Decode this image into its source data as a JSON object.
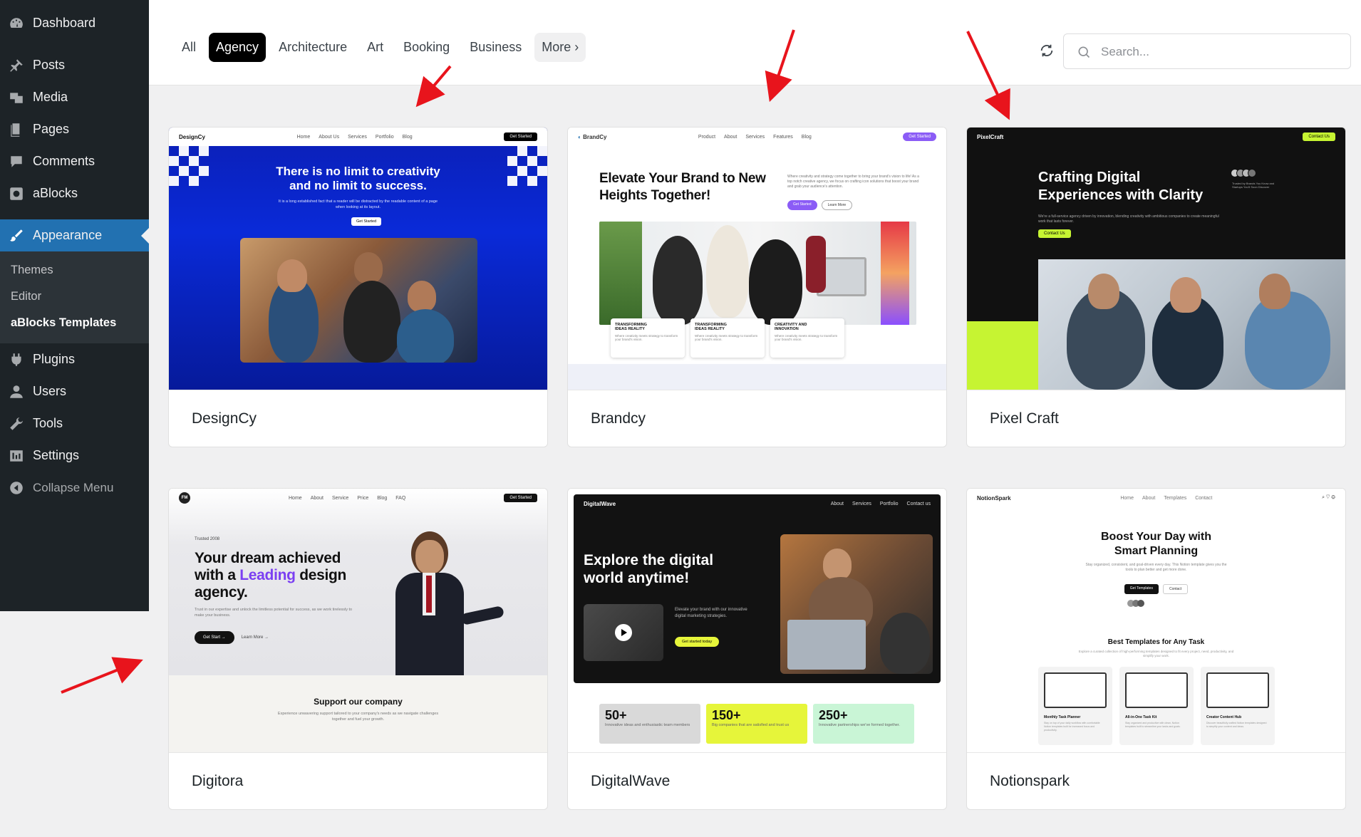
{
  "sidebar": {
    "items": [
      {
        "label": "Dashboard",
        "icon": "dashboard-icon"
      },
      {
        "label": "Posts",
        "icon": "pin-icon"
      },
      {
        "label": "Media",
        "icon": "media-icon"
      },
      {
        "label": "Pages",
        "icon": "pages-icon"
      },
      {
        "label": "Comments",
        "icon": "comment-icon"
      },
      {
        "label": "aBlocks",
        "icon": "ablocks-icon"
      },
      {
        "label": "Appearance",
        "icon": "brush-icon"
      }
    ],
    "submenu": [
      "Themes",
      "Editor",
      "aBlocks Templates"
    ],
    "items2": [
      {
        "label": "Plugins",
        "icon": "plugin-icon"
      },
      {
        "label": "Users",
        "icon": "user-icon"
      },
      {
        "label": "Tools",
        "icon": "wrench-icon"
      },
      {
        "label": "Settings",
        "icon": "settings-icon"
      }
    ],
    "collapse": "Collapse Menu"
  },
  "filters": {
    "categories": [
      "All",
      "Agency",
      "Architecture",
      "Art",
      "Booking",
      "Business"
    ],
    "active": "Agency",
    "more": "More ›"
  },
  "search": {
    "placeholder": "Search..."
  },
  "templates": [
    {
      "name": "DesignCy",
      "preview": {
        "logo": "DesignCy",
        "nav": [
          "Home",
          "About Us",
          "Services",
          "Portfolio",
          "Blog"
        ],
        "cta": "Get Started",
        "headline1": "There is no limit to creativity",
        "headline2": "and no limit to success.",
        "sub": "It is a long established fact that a reader will be distracted by the readable content of a page when looking at its layout.",
        "button": "Get Started"
      }
    },
    {
      "name": "Brandcy",
      "preview": {
        "logo": "BrandCy",
        "nav": [
          "Product",
          "About",
          "Services",
          "Features",
          "Blog"
        ],
        "cta": "Get Started",
        "headline1": "Elevate Your Brand to New",
        "headline2": "Heights Together!",
        "sub": "Where creativity and strategy come together to bring your brand's vision to life! As a top notch creative agency, we focus on crafting icon solutions that boost your brand and grab your audience's attention.",
        "btn1": "Get Started",
        "btn2": "Learn More",
        "features": [
          {
            "t1": "TRANSFORMING",
            "t2": "IDEAS REALITY",
            "d": "Where creativity meets strategy to transform your brand's vision."
          },
          {
            "t1": "TRANSFORMING",
            "t2": "IDEAS REALITY",
            "d": "Where creativity meets strategy to transform your brand's vision."
          },
          {
            "t1": "CREATIVITY AND",
            "t2": "INNOVATION",
            "d": "Where creativity meets strategy to transform your brand's vision."
          }
        ]
      }
    },
    {
      "name": "Pixel Craft",
      "preview": {
        "logo": "PixelCraft",
        "cta": "Contact Us",
        "headline1": "Crafting Digital",
        "headline2": "Experiences with Clarity",
        "sub": "We're a full-service agency driven by innovation, blending creativity with ambitious companies to create meaningful work that lasts forever.",
        "button": "Contact Us",
        "trusted": "Trusted by Brands You Know and Startups You'll Soon Discover"
      }
    },
    {
      "name": "Digitora",
      "preview": {
        "logo": "FM",
        "nav": [
          "Home",
          "About",
          "Service",
          "Price",
          "Blog",
          "FAQ"
        ],
        "cta": "Get Started",
        "trusted": "Trusted 2008",
        "h1": "Your dream achieved",
        "h2a": "with a ",
        "h2b": "Leading",
        "h2c": " design",
        "h3": "agency.",
        "sub": "Trust in our expertise and unlock the limitless potential for success, as we work tirelessly to make your business.",
        "btn1": "Get Start →",
        "btn2": "Learn More →",
        "support": "Support our company",
        "support_sub": "Experience unwavering support tailored to your company's needs as we navigate challenges together and fuel your growth."
      }
    },
    {
      "name": "DigitalWave",
      "preview": {
        "logo": "DigitalWave",
        "nav": [
          "About",
          "Services",
          "Portfolio",
          "Contact us"
        ],
        "h1": "Explore the digital",
        "h2": "world anytime!",
        "sub": "Elevate your brand with our innovative digital marketing strategies.",
        "button": "Get started today",
        "stats": [
          {
            "v": "50+",
            "d": "Innovative ideas and enthusiastic team members",
            "bg": "#d9d9d9"
          },
          {
            "v": "150+",
            "d": "Big companies that are satisfied and trust us",
            "bg": "#e6f53a"
          },
          {
            "v": "250+",
            "d": "Innovative partnerships we've formed together.",
            "bg": "#c9f5d6"
          }
        ]
      }
    },
    {
      "name": "Notionspark",
      "preview": {
        "logo": "NotionSpark",
        "nav": [
          "Home",
          "About",
          "Templates",
          "Contact"
        ],
        "h1": "Boost Your Day with",
        "h2": "Smart Planning",
        "sub": "Stay organized, consistent, and goal-driven every day. This Notion template gives you the tools to plan better and get more done.",
        "btn1": "Get Templates",
        "btn2": "Contact",
        "section": "Best Templates for Any Task",
        "section_sub": "Explore a curated collection of high-performing templates designed to fit every project, need, productivity, and simplify your work.",
        "items": [
          {
            "name": "Monthly Task Planner",
            "d": "Stay on top of your daily workflow with comfortable Notion templates built for increased focus and productivity."
          },
          {
            "name": "All-in-One Task Kit",
            "d": "Stay organized and productive with clean, Notion templates built to streamline your tasks and goals."
          },
          {
            "name": "Creator Content Hub",
            "d": "Discover beautifully crafted Notion templates designed to simplify your content and ideas."
          }
        ]
      }
    }
  ],
  "colors": {
    "sidebar_bg": "#1d2327",
    "active_blue": "#2271b1",
    "pixelcraft_green": "#c6f432",
    "digitora_purple": "#7b3ff2",
    "brandcy_purple": "#8b5cf6",
    "arrow_red": "#e8141c"
  }
}
